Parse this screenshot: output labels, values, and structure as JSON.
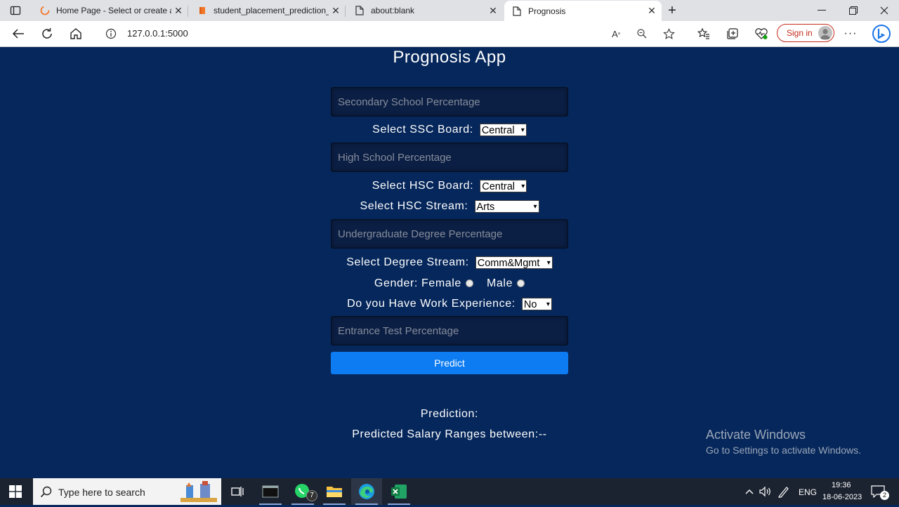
{
  "browser": {
    "tabs": [
      {
        "label": "Home Page - Select or create a n",
        "icon": "loading-ring-icon"
      },
      {
        "label": "student_placement_prediction_fi",
        "icon": "jupyter-notebook-icon"
      },
      {
        "label": "about:blank",
        "icon": "page-icon"
      },
      {
        "label": "Prognosis",
        "icon": "page-icon",
        "active": true
      }
    ],
    "new_tab": "+",
    "url": "127.0.0.1:5000",
    "sign_in": "Sign in",
    "accent": "#c42b1c"
  },
  "page": {
    "title": "Prognosis App",
    "ssc_percentage_placeholder": "Secondary School Percentage",
    "ssc_board_label": "Select SSC Board:",
    "ssc_board_value": "Central",
    "hsc_percentage_placeholder": "High School Percentage",
    "hsc_board_label": "Select HSC Board:",
    "hsc_board_value": "Central",
    "hsc_stream_label": "Select HSC Stream:",
    "hsc_stream_value": "Arts",
    "degree_percentage_placeholder": "Undergraduate Degree Percentage",
    "degree_stream_label": "Select Degree Stream:",
    "degree_stream_value": "Comm&Mgmt",
    "gender_label": "Gender:",
    "gender_female": "Female",
    "gender_male": "Male",
    "work_exp_label": "Do you Have Work Experience:",
    "work_exp_value": "No",
    "entrance_test_placeholder": "Entrance Test Percentage",
    "predict_button": "Predict",
    "prediction_label": "Prediction:",
    "salary_label": "Predicted Salary Ranges between:--",
    "background": "#06275b",
    "button_color": "#0d7cf2"
  },
  "watermark": {
    "line1": "Activate Windows",
    "line2": "Go to Settings to activate Windows."
  },
  "taskbar": {
    "search_placeholder": "Type here to search",
    "whatsapp_badge": "7",
    "language": "ENG",
    "time": "19:36",
    "date": "18-06-2023",
    "notifications": "2"
  }
}
